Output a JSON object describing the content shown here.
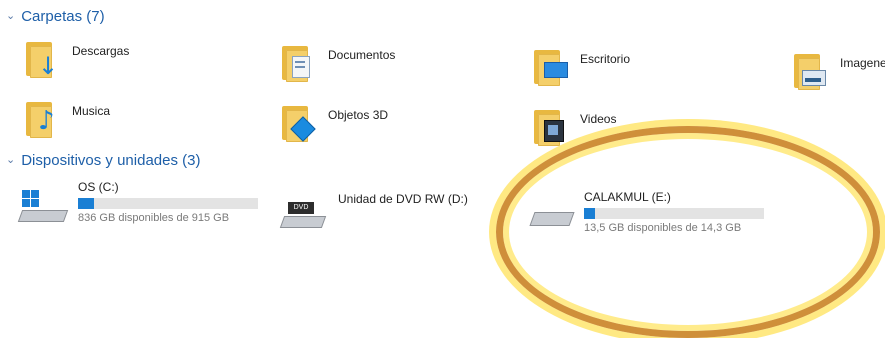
{
  "folders_section": {
    "header": "Carpetas (7)",
    "items": [
      {
        "label": "Descargas",
        "icon": "download-arrow-icon"
      },
      {
        "label": "Documentos",
        "icon": "document-icon"
      },
      {
        "label": "Escritorio",
        "icon": "desktop-icon"
      },
      {
        "label": "Imagenes",
        "icon": "pictures-icon"
      },
      {
        "label": "Musica",
        "icon": "music-note-icon"
      },
      {
        "label": "Objetos 3D",
        "icon": "3d-object-icon"
      },
      {
        "label": "Videos",
        "icon": "film-icon"
      }
    ]
  },
  "devices_section": {
    "header": "Dispositivos y unidades (3)",
    "drives": [
      {
        "name": "OS (C:)",
        "free": "836 GB disponibles de 915 GB",
        "used_fraction": 0.09,
        "icon": "windows-drive-icon"
      },
      {
        "name": "Unidad de DVD RW (D:)",
        "free": "",
        "used_fraction": null,
        "icon": "dvd-drive-icon"
      },
      {
        "name": "CALAKMUL (E:)",
        "free": "13,5 GB disponibles de 14,3 GB",
        "used_fraction": 0.06,
        "icon": "usb-drive-icon"
      }
    ]
  },
  "colors": {
    "header_blue": "#1e5fa8",
    "drive_bar_fill": "#1a7fd4",
    "highlight_ring": "#cf8f3a"
  }
}
